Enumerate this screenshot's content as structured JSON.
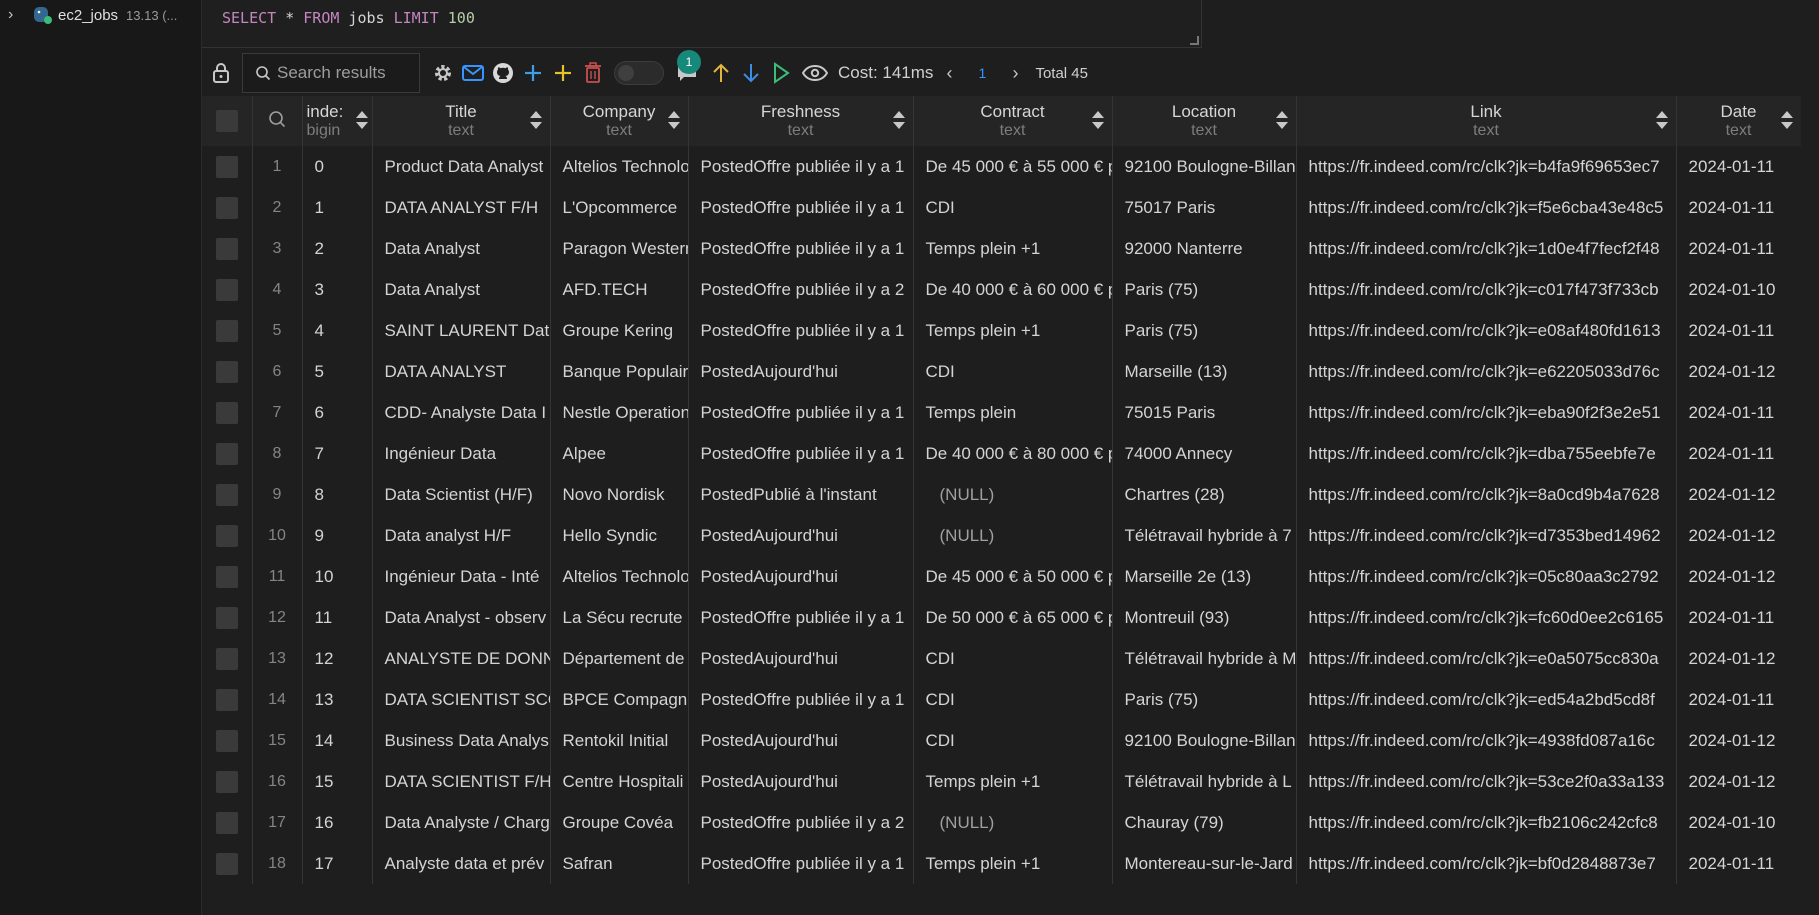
{
  "tree": {
    "chevron": "›",
    "db_icon": "database-elephant-icon",
    "name": "ec2_jobs",
    "version": "13.13 (..."
  },
  "editor": {
    "sql": [
      {
        "t": "SELECT",
        "c": "kw"
      },
      {
        "t": " * ",
        "c": "id"
      },
      {
        "t": "FROM",
        "c": "kw"
      },
      {
        "t": " jobs ",
        "c": "id"
      },
      {
        "t": "LIMIT",
        "c": "kw"
      },
      {
        "t": " ",
        "c": "id"
      },
      {
        "t": "100",
        "c": "num"
      }
    ]
  },
  "toolbar": {
    "search_placeholder": "Search results",
    "mail_badge": "1",
    "cost": "Cost: 141ms",
    "prev": "‹",
    "page": "1",
    "next": "›",
    "total": "Total 45"
  },
  "colors": {
    "accent": "#3794ff",
    "badge": "#16897b",
    "add": "#3c9ee8",
    "add_yellow": "#e2c22d",
    "delete": "#c94f4f",
    "up": "#e2b53c",
    "down": "#3c8de8",
    "run": "#3bbd79"
  },
  "columns": [
    {
      "name": "inde:",
      "type": "bigin"
    },
    {
      "name": "Title",
      "type": "text"
    },
    {
      "name": "Company",
      "type": "text"
    },
    {
      "name": "Freshness",
      "type": "text"
    },
    {
      "name": "Contract",
      "type": "text"
    },
    {
      "name": "Location",
      "type": "text"
    },
    {
      "name": "Link",
      "type": "text"
    },
    {
      "name": "Date",
      "type": "text"
    }
  ],
  "rows": [
    [
      "1",
      "0",
      "Product Data Analyst",
      "Altelios Technolo",
      "PostedOffre publiée il y a 1",
      "De 45 000 € à 55 000 € p",
      "92100 Boulogne-Billan",
      "https://fr.indeed.com/rc/clk?jk=b4fa9f69653ec7",
      "2024-01-11"
    ],
    [
      "2",
      "1",
      "DATA ANALYST F/H",
      "L'Opcommerce",
      "PostedOffre publiée il y a 1",
      "CDI",
      "75017 Paris",
      "https://fr.indeed.com/rc/clk?jk=f5e6cba43e48c5",
      "2024-01-11"
    ],
    [
      "3",
      "2",
      "Data Analyst",
      "Paragon Western",
      "PostedOffre publiée il y a 1",
      "Temps plein +1",
      "92000 Nanterre",
      "https://fr.indeed.com/rc/clk?jk=1d0e4f7fecf2f48",
      "2024-01-11"
    ],
    [
      "4",
      "3",
      "Data Analyst",
      "AFD.TECH",
      "PostedOffre publiée il y a 2",
      "De 40 000 € à 60 000 € p",
      "Paris (75)",
      "https://fr.indeed.com/rc/clk?jk=c017f473f733cb",
      "2024-01-10"
    ],
    [
      "5",
      "4",
      "SAINT LAURENT Data",
      "Groupe Kering",
      "PostedOffre publiée il y a 1",
      "Temps plein +1",
      "Paris (75)",
      "https://fr.indeed.com/rc/clk?jk=e08af480fd1613",
      "2024-01-11"
    ],
    [
      "6",
      "5",
      "DATA ANALYST",
      "Banque Populair",
      "PostedAujourd'hui",
      "CDI",
      "Marseille (13)",
      "https://fr.indeed.com/rc/clk?jk=e62205033d76c",
      "2024-01-12"
    ],
    [
      "7",
      "6",
      "CDD- Analyste Data I",
      "Nestle Operation",
      "PostedOffre publiée il y a 1",
      "Temps plein",
      "75015 Paris",
      "https://fr.indeed.com/rc/clk?jk=eba90f2f3e2e51",
      "2024-01-11"
    ],
    [
      "8",
      "7",
      "Ingénieur Data",
      "Alpee",
      "PostedOffre publiée il y a 1",
      "De 40 000 € à 80 000 € p",
      "74000 Annecy",
      "https://fr.indeed.com/rc/clk?jk=dba755eebfe7e",
      "2024-01-11"
    ],
    [
      "9",
      "8",
      "Data Scientist (H/F)",
      "Novo Nordisk",
      "PostedPublié à l'instant",
      "(NULL)",
      "Chartres (28)",
      "https://fr.indeed.com/rc/clk?jk=8a0cd9b4a7628",
      "2024-01-12"
    ],
    [
      "10",
      "9",
      "Data analyst H/F",
      "Hello Syndic",
      "PostedAujourd'hui",
      "(NULL)",
      "Télétravail hybride à 7",
      "https://fr.indeed.com/rc/clk?jk=d7353bed14962",
      "2024-01-12"
    ],
    [
      "11",
      "10",
      "Ingénieur Data - Inté",
      "Altelios Technolo",
      "PostedAujourd'hui",
      "De 45 000 € à 50 000 € p",
      "Marseille 2e (13)",
      "https://fr.indeed.com/rc/clk?jk=05c80aa3c2792",
      "2024-01-12"
    ],
    [
      "12",
      "11",
      "Data Analyst - observ",
      "La Sécu recrute",
      "PostedOffre publiée il y a 1",
      "De 50 000 € à 65 000 € p",
      "Montreuil (93)",
      "https://fr.indeed.com/rc/clk?jk=fc60d0ee2c6165",
      "2024-01-11"
    ],
    [
      "13",
      "12",
      "ANALYSTE DE DONN",
      "Département de",
      "PostedAujourd'hui",
      "CDI",
      "Télétravail hybride à M",
      "https://fr.indeed.com/rc/clk?jk=e0a5075cc830a",
      "2024-01-12"
    ],
    [
      "14",
      "13",
      "DATA SCIENTIST SCO",
      "BPCE Compagni",
      "PostedOffre publiée il y a 1",
      "CDI",
      "Paris (75)",
      "https://fr.indeed.com/rc/clk?jk=ed54a2bd5cd8f",
      "2024-01-11"
    ],
    [
      "15",
      "14",
      "Business Data Analys",
      "Rentokil Initial",
      "PostedAujourd'hui",
      "CDI",
      "92100 Boulogne-Billan",
      "https://fr.indeed.com/rc/clk?jk=4938fd087a16c",
      "2024-01-12"
    ],
    [
      "16",
      "15",
      "DATA SCIENTIST F/H",
      "Centre Hospitali",
      "PostedAujourd'hui",
      "Temps plein +1",
      "Télétravail hybride à L",
      "https://fr.indeed.com/rc/clk?jk=53ce2f0a33a133",
      "2024-01-12"
    ],
    [
      "17",
      "16",
      "Data Analyste / Charg",
      "Groupe Covéa",
      "PostedOffre publiée il y a 2",
      "(NULL)",
      "Chauray (79)",
      "https://fr.indeed.com/rc/clk?jk=fb2106c242cfc8",
      "2024-01-10"
    ],
    [
      "18",
      "17",
      "Analyste data et prév",
      "Safran",
      "PostedOffre publiée il y a 1",
      "Temps plein +1",
      "Montereau-sur-le-Jard",
      "https://fr.indeed.com/rc/clk?jk=bf0d2848873e7",
      "2024-01-11"
    ]
  ]
}
